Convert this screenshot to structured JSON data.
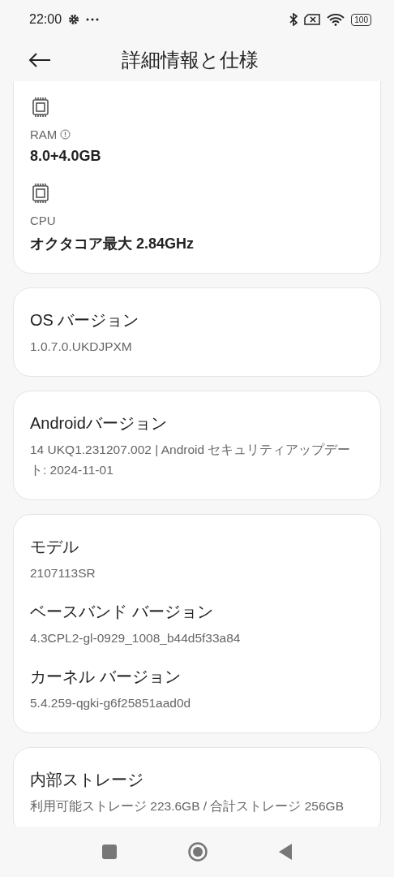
{
  "status_bar": {
    "time": "22:00",
    "battery": "100"
  },
  "header": {
    "title": "詳細情報と仕様"
  },
  "spec_card": {
    "items": [
      {
        "label": "RAM",
        "info": true,
        "value": "8.0+4.0GB"
      },
      {
        "label": "CPU",
        "info": false,
        "value": "オクタコア最大 2.84GHz"
      }
    ]
  },
  "cards": [
    {
      "items": [
        {
          "title": "OS バージョン",
          "value": "1.0.7.0.UKDJPXM"
        }
      ]
    },
    {
      "items": [
        {
          "title": "Androidバージョン",
          "value": "14 UKQ1.231207.002 | Android セキュリティアップデート: 2024-11-01"
        }
      ]
    },
    {
      "items": [
        {
          "title": "モデル",
          "value": "2107113SR"
        },
        {
          "title": "ベースバンド バージョン",
          "value": "4.3CPL2-gl-0929_1008_b44d5f33a84"
        },
        {
          "title": "カーネル バージョン",
          "value": "5.4.259-qgki-g6f25851aad0d"
        }
      ]
    },
    {
      "items": [
        {
          "title": "内部ストレージ",
          "value": "利用可能ストレージ  223.6GB / 合計ストレージ 256GB"
        }
      ]
    }
  ]
}
